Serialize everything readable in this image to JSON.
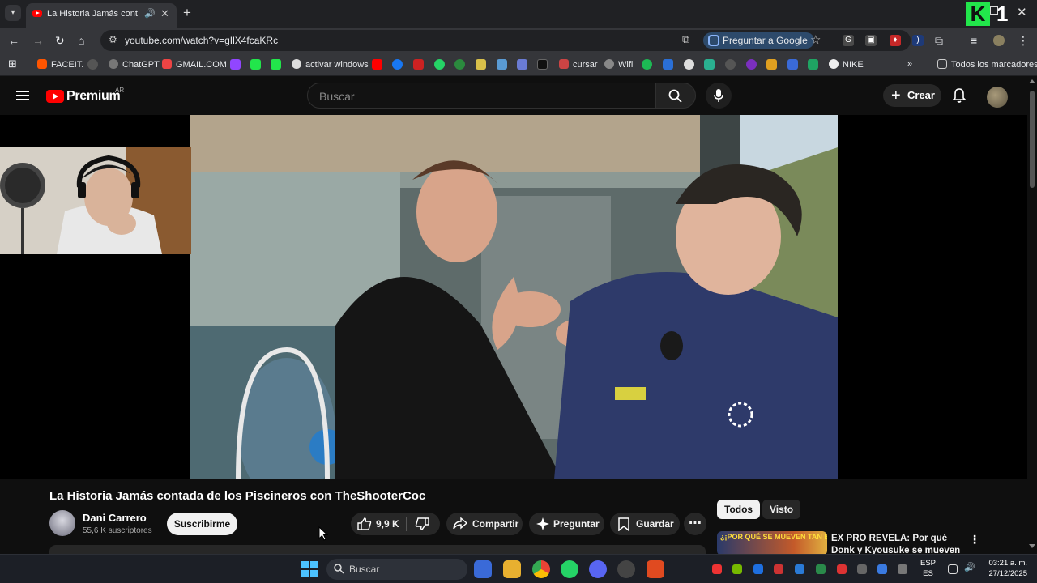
{
  "browser": {
    "tab_title": "La Historia Jamás contada de",
    "address": "youtube.com/watch?v=gIlX4fcaKRc",
    "ask_google": "Preguntar a Google",
    "bookmarks": [
      "FACEIT.",
      "ChatGPT",
      "GMAIL.COM",
      "activar windows",
      "cursar",
      "Wifi",
      "NIKE"
    ],
    "all_bookmarks": "Todos los marcadores",
    "brand_color": "#ff0000"
  },
  "youtube": {
    "brand": "Premium",
    "region": "AR",
    "search_placeholder": "Buscar",
    "create_label": "Crear"
  },
  "video": {
    "title": "La Historia Jamás contada de los Piscineros con TheShooterCoc",
    "channel_name": "Dani Carrero",
    "subscribers": "55,6 K suscriptores",
    "subscribe_label": "Suscribirme",
    "likes": "9,9 K",
    "share_label": "Compartir",
    "ask_label": "Preguntar",
    "save_label": "Guardar"
  },
  "sidebar": {
    "chips": [
      "Todos",
      "Visto"
    ],
    "recommendation_title": "EX PRO REVELA: Por qué Donk y Kyousuke se mueven como",
    "recommendation_thumb_text": "¿¡POR QUÉ SE MUEVEN TAN BIEN?!"
  },
  "taskbar": {
    "search_label": "Buscar",
    "lang_line1": "ESP",
    "lang_line2": "ES",
    "time": "03:21 a. m.",
    "date": "27/12/2025"
  }
}
